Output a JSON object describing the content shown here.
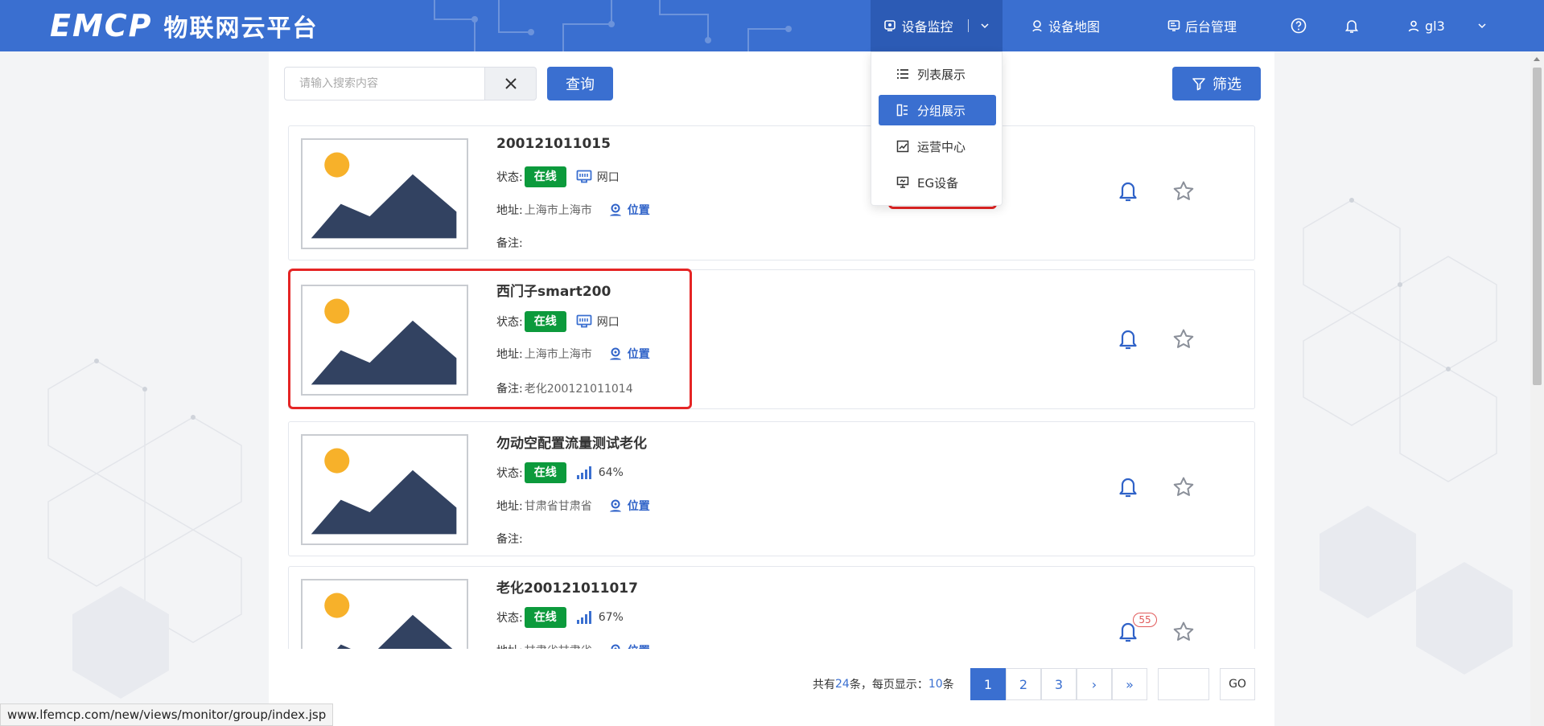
{
  "header": {
    "brand": "EMCP",
    "brand_cn": "物联网云平台",
    "nav": {
      "monitor": "设备监控",
      "map": "设备地图",
      "admin": "后台管理",
      "user": "gl3"
    }
  },
  "dropdown": {
    "items": [
      {
        "label": "列表展示",
        "icon": "list-icon"
      },
      {
        "label": "分组展示",
        "icon": "group-icon",
        "active": true
      },
      {
        "label": "运营中心",
        "icon": "chart-icon"
      },
      {
        "label": "EG设备",
        "icon": "monitor-icon"
      }
    ]
  },
  "toolbar": {
    "search_placeholder": "请输入搜索内容",
    "query_label": "查询",
    "filter_label": "筛选"
  },
  "labels": {
    "status": "状态:",
    "address": "地址:",
    "note": "备注:",
    "location": "位置"
  },
  "devices": [
    {
      "title": "200121011015",
      "status": "在线",
      "conn_type": "ethernet",
      "conn_label": "网口",
      "address": "上海市上海市",
      "note": ""
    },
    {
      "title": "西门子smart200",
      "status": "在线",
      "conn_type": "ethernet",
      "conn_label": "网口",
      "address": "上海市上海市",
      "note": "老化200121011014"
    },
    {
      "title": "勿动空配置流量测试老化",
      "status": "在线",
      "conn_type": "signal",
      "conn_label": "64%",
      "address": "甘肃省甘肃省",
      "note": ""
    },
    {
      "title": "老化200121011017",
      "status": "在线",
      "conn_type": "signal",
      "conn_label": "67%",
      "address": "甘肃省甘肃省",
      "note": "",
      "alarm_count": "55"
    }
  ],
  "pagination": {
    "total_prefix": "共有",
    "total": "24",
    "total_mid": "条，每页显示：",
    "per_page": "10",
    "total_suffix": "条",
    "pages": [
      "1",
      "2",
      "3"
    ],
    "next": "›",
    "last": "»",
    "go_label": "GO"
  },
  "statusbar": {
    "url": "www.lfemcp.com/new/views/monitor/group/index.jsp"
  },
  "colors": {
    "primary": "#3a6fd0",
    "online": "#0c9a3c",
    "highlight": "#e52525"
  }
}
